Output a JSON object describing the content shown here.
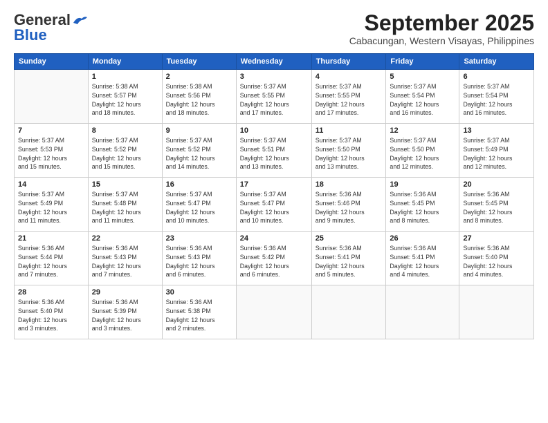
{
  "header": {
    "logo_general": "General",
    "logo_blue": "Blue",
    "month": "September 2025",
    "location": "Cabacungan, Western Visayas, Philippines"
  },
  "days_of_week": [
    "Sunday",
    "Monday",
    "Tuesday",
    "Wednesday",
    "Thursday",
    "Friday",
    "Saturday"
  ],
  "weeks": [
    [
      {
        "num": "",
        "info": ""
      },
      {
        "num": "1",
        "info": "Sunrise: 5:38 AM\nSunset: 5:57 PM\nDaylight: 12 hours\nand 18 minutes."
      },
      {
        "num": "2",
        "info": "Sunrise: 5:38 AM\nSunset: 5:56 PM\nDaylight: 12 hours\nand 18 minutes."
      },
      {
        "num": "3",
        "info": "Sunrise: 5:37 AM\nSunset: 5:55 PM\nDaylight: 12 hours\nand 17 minutes."
      },
      {
        "num": "4",
        "info": "Sunrise: 5:37 AM\nSunset: 5:55 PM\nDaylight: 12 hours\nand 17 minutes."
      },
      {
        "num": "5",
        "info": "Sunrise: 5:37 AM\nSunset: 5:54 PM\nDaylight: 12 hours\nand 16 minutes."
      },
      {
        "num": "6",
        "info": "Sunrise: 5:37 AM\nSunset: 5:54 PM\nDaylight: 12 hours\nand 16 minutes."
      }
    ],
    [
      {
        "num": "7",
        "info": "Sunrise: 5:37 AM\nSunset: 5:53 PM\nDaylight: 12 hours\nand 15 minutes."
      },
      {
        "num": "8",
        "info": "Sunrise: 5:37 AM\nSunset: 5:52 PM\nDaylight: 12 hours\nand 15 minutes."
      },
      {
        "num": "9",
        "info": "Sunrise: 5:37 AM\nSunset: 5:52 PM\nDaylight: 12 hours\nand 14 minutes."
      },
      {
        "num": "10",
        "info": "Sunrise: 5:37 AM\nSunset: 5:51 PM\nDaylight: 12 hours\nand 13 minutes."
      },
      {
        "num": "11",
        "info": "Sunrise: 5:37 AM\nSunset: 5:50 PM\nDaylight: 12 hours\nand 13 minutes."
      },
      {
        "num": "12",
        "info": "Sunrise: 5:37 AM\nSunset: 5:50 PM\nDaylight: 12 hours\nand 12 minutes."
      },
      {
        "num": "13",
        "info": "Sunrise: 5:37 AM\nSunset: 5:49 PM\nDaylight: 12 hours\nand 12 minutes."
      }
    ],
    [
      {
        "num": "14",
        "info": "Sunrise: 5:37 AM\nSunset: 5:49 PM\nDaylight: 12 hours\nand 11 minutes."
      },
      {
        "num": "15",
        "info": "Sunrise: 5:37 AM\nSunset: 5:48 PM\nDaylight: 12 hours\nand 11 minutes."
      },
      {
        "num": "16",
        "info": "Sunrise: 5:37 AM\nSunset: 5:47 PM\nDaylight: 12 hours\nand 10 minutes."
      },
      {
        "num": "17",
        "info": "Sunrise: 5:37 AM\nSunset: 5:47 PM\nDaylight: 12 hours\nand 10 minutes."
      },
      {
        "num": "18",
        "info": "Sunrise: 5:36 AM\nSunset: 5:46 PM\nDaylight: 12 hours\nand 9 minutes."
      },
      {
        "num": "19",
        "info": "Sunrise: 5:36 AM\nSunset: 5:45 PM\nDaylight: 12 hours\nand 8 minutes."
      },
      {
        "num": "20",
        "info": "Sunrise: 5:36 AM\nSunset: 5:45 PM\nDaylight: 12 hours\nand 8 minutes."
      }
    ],
    [
      {
        "num": "21",
        "info": "Sunrise: 5:36 AM\nSunset: 5:44 PM\nDaylight: 12 hours\nand 7 minutes."
      },
      {
        "num": "22",
        "info": "Sunrise: 5:36 AM\nSunset: 5:43 PM\nDaylight: 12 hours\nand 7 minutes."
      },
      {
        "num": "23",
        "info": "Sunrise: 5:36 AM\nSunset: 5:43 PM\nDaylight: 12 hours\nand 6 minutes."
      },
      {
        "num": "24",
        "info": "Sunrise: 5:36 AM\nSunset: 5:42 PM\nDaylight: 12 hours\nand 6 minutes."
      },
      {
        "num": "25",
        "info": "Sunrise: 5:36 AM\nSunset: 5:41 PM\nDaylight: 12 hours\nand 5 minutes."
      },
      {
        "num": "26",
        "info": "Sunrise: 5:36 AM\nSunset: 5:41 PM\nDaylight: 12 hours\nand 4 minutes."
      },
      {
        "num": "27",
        "info": "Sunrise: 5:36 AM\nSunset: 5:40 PM\nDaylight: 12 hours\nand 4 minutes."
      }
    ],
    [
      {
        "num": "28",
        "info": "Sunrise: 5:36 AM\nSunset: 5:40 PM\nDaylight: 12 hours\nand 3 minutes."
      },
      {
        "num": "29",
        "info": "Sunrise: 5:36 AM\nSunset: 5:39 PM\nDaylight: 12 hours\nand 3 minutes."
      },
      {
        "num": "30",
        "info": "Sunrise: 5:36 AM\nSunset: 5:38 PM\nDaylight: 12 hours\nand 2 minutes."
      },
      {
        "num": "",
        "info": ""
      },
      {
        "num": "",
        "info": ""
      },
      {
        "num": "",
        "info": ""
      },
      {
        "num": "",
        "info": ""
      }
    ]
  ]
}
